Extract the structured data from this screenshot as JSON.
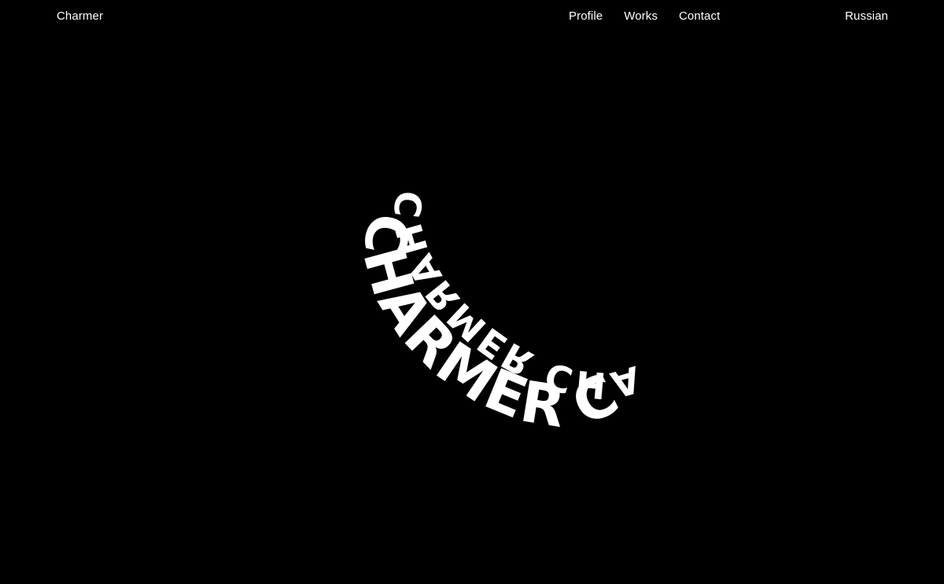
{
  "header": {
    "brand": "Charmer",
    "nav": [
      {
        "label": "Profile"
      },
      {
        "label": "Works"
      },
      {
        "label": "Contact"
      }
    ],
    "language": "Russian"
  },
  "hero": {
    "ring_front_text": "CHARMER CHARMER",
    "ring_back_text": "CHARMER CHARMER",
    "colors": {
      "background": "#000000",
      "text": "#ffffff"
    }
  }
}
